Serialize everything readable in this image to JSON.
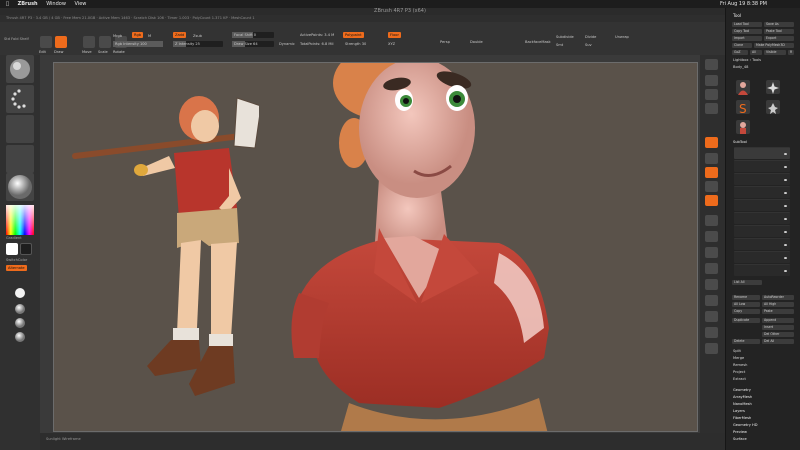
{
  "menubar": {
    "apple": "",
    "app": "ZBrush",
    "window": "Window",
    "view": "View",
    "clock": "Fri Aug 19 8:38 PM"
  },
  "window_title": "ZBrush 4R7 P3 (x64)",
  "info_bar": "Thrush 4R7 P3 · 3.4 GB / 4 GB · Free Mem 21.0GB · Active Mem 1463 · Scratch Disk 106 · Timer 1.003 · PolyCount 1.371 KP · MeshCount 1",
  "toolbar": {
    "edit_label": "Edit",
    "draw_label": "Draw",
    "move_label": "Move",
    "scale_label": "Scale",
    "rotate_label": "Rotate",
    "mrgb": "Mrgb",
    "rgb": "Rgb",
    "m": "M",
    "rgb_intensity": "Rgb Intensity 100",
    "zadd": "Zadd",
    "zsub": "Zsub",
    "z_intensity": "Z Intensity 25",
    "focal_shift": "Focal Shift 0",
    "draw_size": "Draw Size 64",
    "dynamic": "Dynamic",
    "active_points": "ActivePoints: 3.4 M",
    "total_points": "TotalPoints: 6.8 Mil",
    "polypaint": "Polypaint",
    "strength": "Strength 30",
    "floor": "Floor",
    "xyz": "XYZ",
    "persp": "Persp",
    "subdivide": "Subdivide",
    "divide": "Divide",
    "smt": "Smt",
    "suv": "Suv",
    "unwrap": "Unwrap",
    "backface": "BackfaceMask",
    "double": "Double"
  },
  "left_shelf": {
    "brush_label": "Std Fold Shelf",
    "material_label": "MatCap",
    "gradient": "Gradient",
    "switch_color": "SwitchColor",
    "alternate": "Alternate",
    "colors": {
      "primary": "#ffffff",
      "secondary": "#1e1e1e",
      "accent": "#ee6b1c"
    }
  },
  "tool_panel": {
    "title": "Tool",
    "load_tool": "Load Tool",
    "save_as": "Save As",
    "copy_tool": "Copy Tool",
    "paste_tool": "Paste Tool",
    "import": "Import",
    "export": "Export",
    "clone": "Clone",
    "make_polymesh": "Make PolyMesh3D",
    "goz": "GoZ",
    "all": "All",
    "visible": "Visible",
    "r": "R",
    "lightbox_tools": "Lightbox › Tools",
    "current_tool": "Body_48",
    "subtool": "SubTool",
    "list_all": "List All",
    "rename": "Rename",
    "autoreorder": "AutoReorder",
    "all_low": "All Low",
    "all_high": "All High",
    "copy": "Copy",
    "paste": "Paste",
    "duplicate": "Duplicate",
    "append": "Append",
    "insert": "Insert",
    "del_other": "Del Other",
    "delete": "Delete",
    "del_all": "Del All",
    "split": "Split",
    "merge": "Merge",
    "remesh": "Remesh",
    "project": "Project",
    "extract": "Extract",
    "sections": [
      "Geometry",
      "ArrayMesh",
      "NanoMesh",
      "Layers",
      "FiberMesh",
      "Geometry HD",
      "Preview",
      "Surface"
    ]
  },
  "status_bar": "Sunlight Wireframe",
  "colors": {
    "accent": "#ee6b1c",
    "canvas_bg": "#5a524a",
    "panel": "#232323"
  }
}
